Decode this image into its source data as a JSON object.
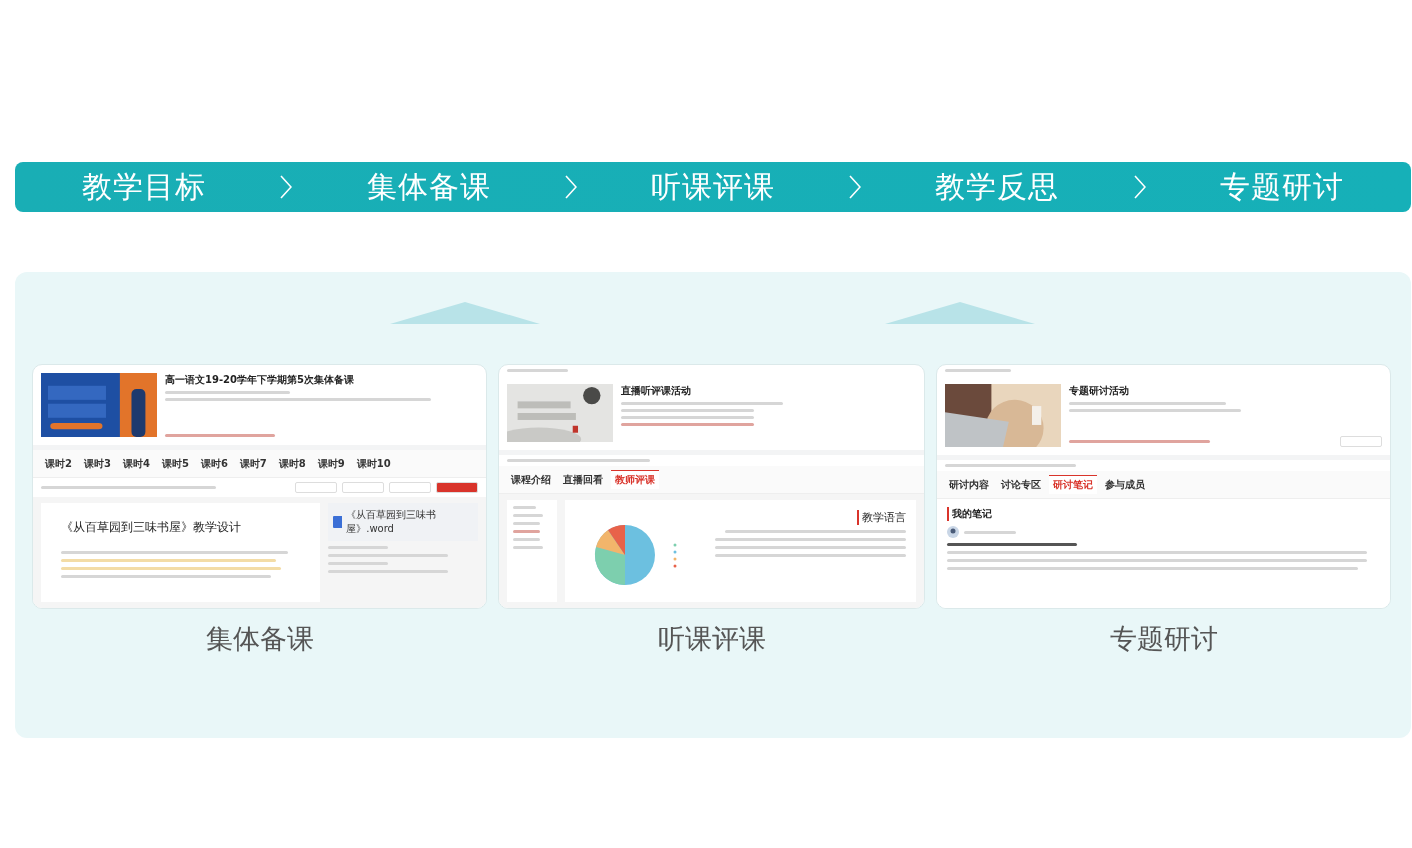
{
  "steps": [
    {
      "label": "教学目标"
    },
    {
      "label": "集体备课"
    },
    {
      "label": "听课评课"
    },
    {
      "label": "教学反思"
    },
    {
      "label": "专题研讨"
    }
  ],
  "cards": [
    {
      "kind": "prep",
      "title": "高一语文19-20学年下学期第5次集体备课",
      "tabs": [
        {
          "label": "课时2",
          "selected": false
        },
        {
          "label": "课时3",
          "selected": false
        },
        {
          "label": "课时4",
          "selected": false
        },
        {
          "label": "课时5",
          "selected": false
        },
        {
          "label": "课时6",
          "selected": false
        },
        {
          "label": "课时7",
          "selected": false
        },
        {
          "label": "课时8",
          "selected": false
        },
        {
          "label": "课时9",
          "selected": false
        },
        {
          "label": "课时10",
          "selected": false
        }
      ],
      "doc_title": "《从百草园到三味书屋》教学设计",
      "file": "《从百草园到三味书屋》.word",
      "caption": "集体备课"
    },
    {
      "kind": "observe",
      "title": "直播听评课活动",
      "tabs": [
        {
          "label": "课程介绍",
          "selected": false
        },
        {
          "label": "直播回看",
          "selected": false
        },
        {
          "label": "教师评课",
          "selected": true
        }
      ],
      "section": "教学语言",
      "caption": "听课评课"
    },
    {
      "kind": "seminar",
      "title": "专题研讨活动",
      "tabs": [
        {
          "label": "研讨内容",
          "selected": false
        },
        {
          "label": "讨论专区",
          "selected": false
        },
        {
          "label": "研讨笔记",
          "selected": true
        },
        {
          "label": "参与成员",
          "selected": false
        }
      ],
      "section": "我的笔记",
      "caption": "专题研讨"
    }
  ]
}
